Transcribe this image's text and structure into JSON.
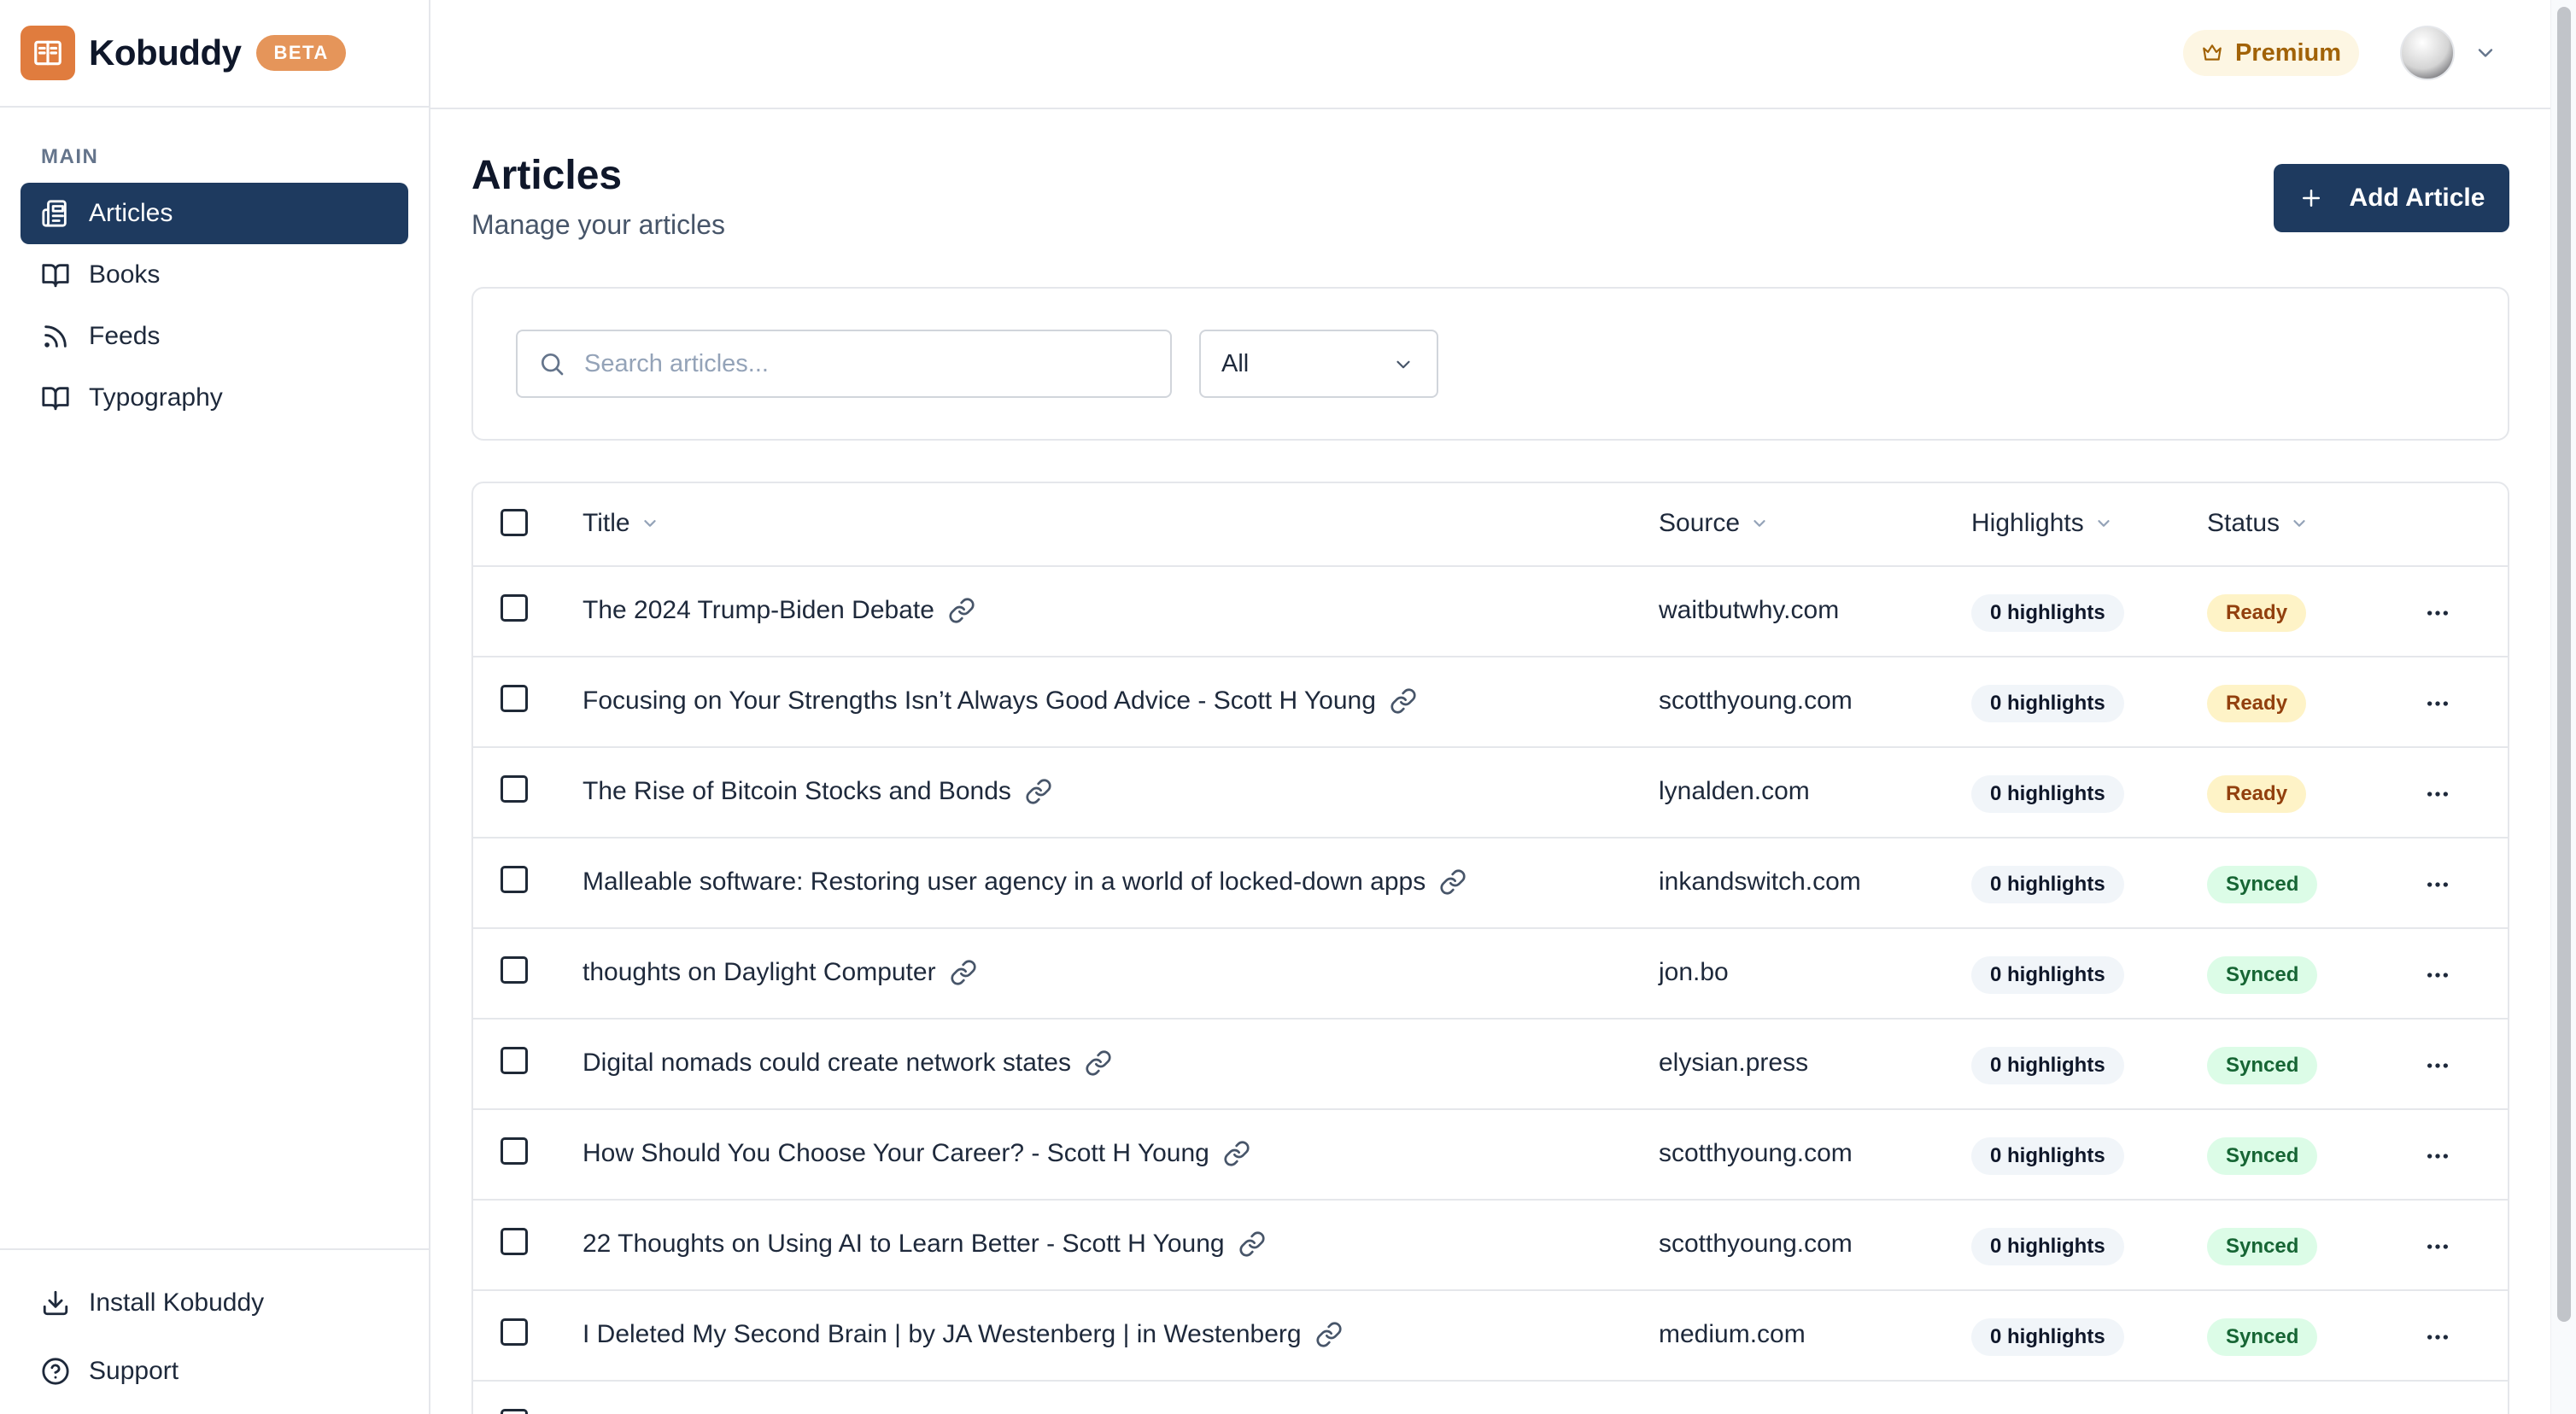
{
  "app": {
    "name": "Kobuddy",
    "badge": "BETA",
    "logo_icon": "book-open-icon",
    "accent_color": "#e07c3e",
    "primary_color": "#1e3a5f"
  },
  "sidebar": {
    "section_label": "MAIN",
    "items": [
      {
        "label": "Articles",
        "icon": "articles-icon",
        "active": true
      },
      {
        "label": "Books",
        "icon": "book-icon",
        "active": false
      },
      {
        "label": "Feeds",
        "icon": "rss-icon",
        "active": false
      },
      {
        "label": "Typography",
        "icon": "book-icon",
        "active": false
      }
    ],
    "footer": [
      {
        "label": "Install Kobuddy",
        "icon": "download-icon"
      },
      {
        "label": "Support",
        "icon": "help-circle-icon"
      }
    ]
  },
  "topbar": {
    "premium_label": "Premium",
    "premium_icon": "crown-icon",
    "avatar_icon": "avatar",
    "menu_icon": "chevron-down-icon"
  },
  "page": {
    "title": "Articles",
    "subtitle": "Manage your articles",
    "add_button": "Add Article"
  },
  "filters": {
    "search_placeholder": "Search articles...",
    "select_value": "All"
  },
  "table": {
    "columns": [
      "Title",
      "Source",
      "Highlights",
      "Status"
    ],
    "rows": [
      {
        "title": "The 2024 Trump-Biden Debate",
        "source": "waitbutwhy.com",
        "highlights": "0 highlights",
        "status": "Ready"
      },
      {
        "title": "Focusing on Your Strengths Isn’t Always Good Advice - Scott H Young",
        "source": "scotthyoung.com",
        "highlights": "0 highlights",
        "status": "Ready"
      },
      {
        "title": "The Rise of Bitcoin Stocks and Bonds",
        "source": "lynalden.com",
        "highlights": "0 highlights",
        "status": "Ready"
      },
      {
        "title": "Malleable software: Restoring user agency in a world of locked-down apps",
        "source": "inkandswitch.com",
        "highlights": "0 highlights",
        "status": "Synced"
      },
      {
        "title": "thoughts on Daylight Computer",
        "source": "jon.bo",
        "highlights": "0 highlights",
        "status": "Synced"
      },
      {
        "title": "Digital nomads could create network states",
        "source": "elysian.press",
        "highlights": "0 highlights",
        "status": "Synced"
      },
      {
        "title": "How Should You Choose Your Career? - Scott H Young",
        "source": "scotthyoung.com",
        "highlights": "0 highlights",
        "status": "Synced"
      },
      {
        "title": "22 Thoughts on Using AI to Learn Better - Scott H Young",
        "source": "scotthyoung.com",
        "highlights": "0 highlights",
        "status": "Synced"
      },
      {
        "title": "I Deleted My Second Brain | by JA Westenberg | in Westenberg",
        "source": "medium.com",
        "highlights": "0 highlights",
        "status": "Synced"
      }
    ],
    "status_colors": {
      "Ready": {
        "bg": "#fef3c7",
        "fg": "#92400e"
      },
      "Synced": {
        "bg": "#dcfce7",
        "fg": "#166534"
      }
    }
  }
}
